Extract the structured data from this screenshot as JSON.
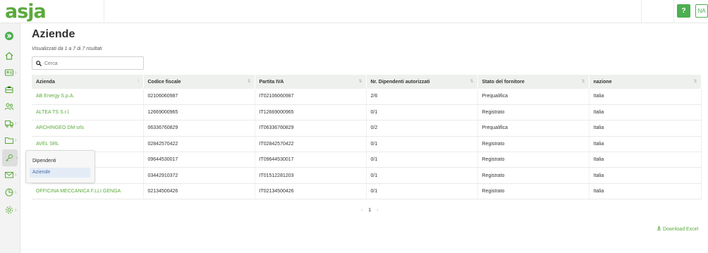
{
  "app": {
    "logo": "asja",
    "help": "?",
    "user_initials": "NA"
  },
  "sidebar": {
    "items": [
      {
        "name": "home-icon",
        "chevron": false
      },
      {
        "name": "id-card-icon",
        "chevron": true
      },
      {
        "name": "briefcase-icon",
        "chevron": false
      },
      {
        "name": "users-icon",
        "chevron": false
      },
      {
        "name": "truck-icon",
        "chevron": true
      },
      {
        "name": "folder-icon",
        "chevron": true
      },
      {
        "name": "key-icon",
        "chevron": true
      },
      {
        "name": "mail-icon",
        "chevron": true
      },
      {
        "name": "chart-icon",
        "chevron": true
      },
      {
        "name": "settings-icon",
        "chevron": true
      }
    ]
  },
  "flyout": {
    "title": "Dipendenti",
    "item": "Aziende"
  },
  "page": {
    "title": "Aziende",
    "results": "Visualizzati da 1 a 7 di 7 risultati",
    "search_placeholder": "Cerca"
  },
  "table": {
    "headers": [
      "Azienda",
      "Codice fiscale",
      "Partita IVA",
      "Nr. Dipendenti autorizzati",
      "Stato del fornitore",
      "nazione"
    ],
    "rows": [
      [
        "AB Energy S.p.A.",
        "02106060987",
        "IT02106060987",
        "2/6",
        "Prequalifica",
        "Italia"
      ],
      [
        "ALTEA TS S.r.l.",
        "12669000965",
        "IT12669000965",
        "0/1",
        "Registrato",
        "Italia"
      ],
      [
        "ARCHINGEO DM srls",
        "06336760829",
        "IT06336760829",
        "0/2",
        "Prequalifica",
        "Italia"
      ],
      [
        "AVEL SRL",
        "02842570422",
        "IT02842570422",
        "0/1",
        "Registrato",
        "Italia"
      ],
      [
        "",
        "09644530017",
        "IT09644530017",
        "0/1",
        "Registrato",
        "Italia"
      ],
      [
        "",
        "03442910372",
        "IT01512281203",
        "0/1",
        "Registrato",
        "Italia"
      ],
      [
        "OFFICINA MECCANICA F.LLI GENGA",
        "02134500426",
        "IT02134500426",
        "0/1",
        "Registrato",
        "Italia"
      ]
    ]
  },
  "pagination": {
    "prev": "‹",
    "current": "1",
    "next": "›"
  },
  "download": {
    "label": "Download Excel"
  },
  "colors": {
    "accent": "#4caf50",
    "link": "#5aaa3c"
  }
}
